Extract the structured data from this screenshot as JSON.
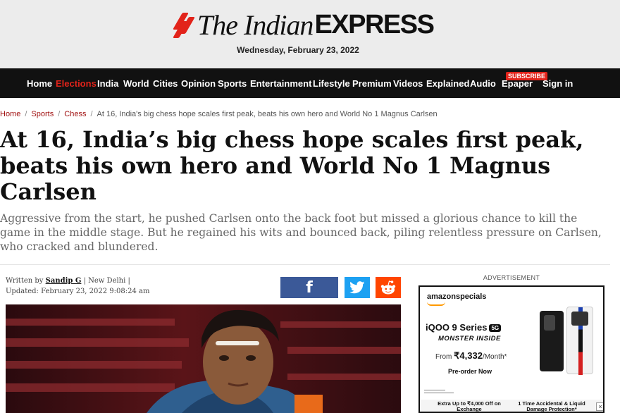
{
  "masthead": {
    "logo_prefix": "The Indian",
    "logo_suffix": "EXPRESS",
    "date": "Wednesday, February 23, 2022"
  },
  "nav": {
    "items": [
      "Home",
      "Elections",
      "India",
      "World",
      "Cities",
      "Opinion",
      "Sports",
      "Entertainment",
      "Lifestyle",
      "Premium",
      "Videos",
      "Explained",
      "Audio",
      "Epaper",
      "Sign in"
    ],
    "subscribe_badge": "SUBSCRIBE",
    "active_color": "#e2231a"
  },
  "breadcrumb": {
    "items": [
      "Home",
      "Sports",
      "Chess"
    ],
    "current": "At 16, India's big chess hope scales first peak, beats his own hero and World No 1 Magnus Carlsen"
  },
  "article": {
    "headline": "At 16, India’s big chess hope scales first peak, beats his own hero and World No 1 Magnus Carlsen",
    "subheadline": "Aggressive from the start, he pushed Carlsen onto the back foot but missed a glorious chance to kill the game in the middle stage. But he regained his wits and bounced back, piling relentless pressure on Carlsen, who cracked and blundered.",
    "byline_prefix": "Written by",
    "author": "Sandip G",
    "location": "| New Delhi |",
    "updated": "Updated: February 23, 2022 9:08:24 am"
  },
  "share": {
    "facebook_icon": "facebook-icon",
    "twitter_icon": "twitter-icon",
    "reddit_icon": "reddit-icon"
  },
  "advert": {
    "label": "ADVERTISEMENT",
    "brand": "amazonspecials",
    "product": "iQOO 9 Series",
    "badge": "5G",
    "tagline": "MONSTER INSIDE",
    "price_prefix": "From",
    "price": "₹4,332",
    "price_suffix": "/Month*",
    "cta": "Pre-order Now",
    "offer1": "Extra Up to ₹4,000 Off on Exchange",
    "offer2": "1 Time Accidental & Liquid Damage Protection*"
  }
}
